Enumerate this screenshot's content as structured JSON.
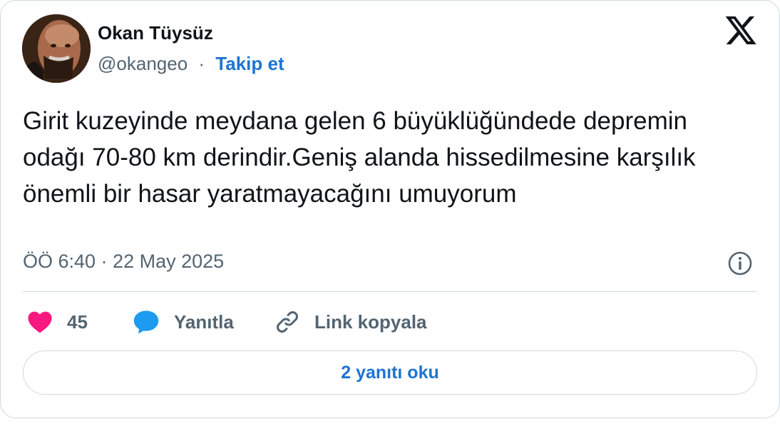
{
  "author": {
    "name": "Okan Tüysüz",
    "handle": "@okangeo",
    "separator": "·",
    "follow_label": "Takip et"
  },
  "tweet": {
    "text": "Girit kuzeyinde meydana gelen 6 büyüklüğündede depremin odağı 70-80 km derindir.Geniş alanda hissedilmesine karşılık önemli bir hasar yaratmayacağını umuyorum",
    "timestamp": "ÖÖ 6:40 · 22 May 2025"
  },
  "actions": {
    "like_count": "45",
    "reply_label": "Yanıtla",
    "copy_link_label": "Link kopyala"
  },
  "footer": {
    "read_replies_label": "2 yanıtı oku"
  },
  "icons": {
    "platform": "x-logo-icon",
    "info": "info-icon",
    "like": "heart-icon",
    "reply": "speech-bubble-icon",
    "link": "link-icon"
  },
  "colors": {
    "text": "#0f1419",
    "secondary": "#536471",
    "link_blue": "#1d74d2",
    "heart": "#f91880",
    "reply_blue": "#1d9bf0",
    "border": "#cfd9de"
  }
}
